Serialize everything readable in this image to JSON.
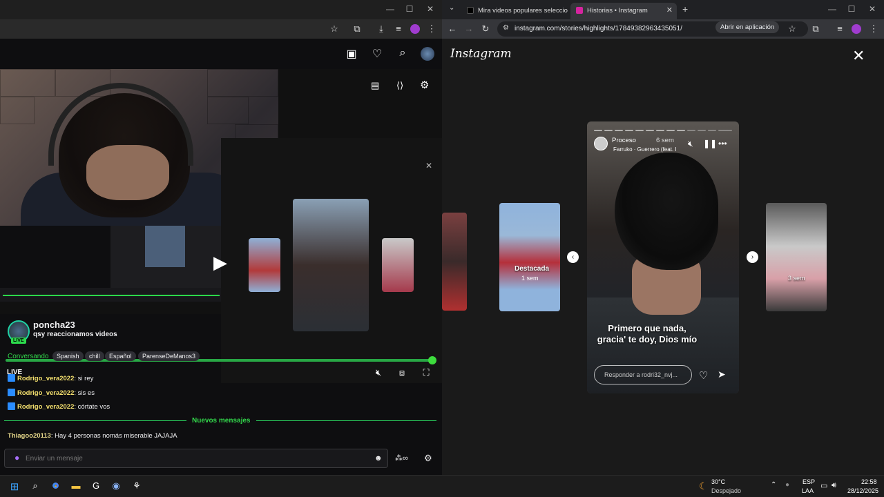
{
  "left_window": {
    "player": {
      "live_label": "LIVE"
    },
    "channel": {
      "name": "poncha23",
      "title": "qsy reaccionamos videos",
      "live_badge": "LIVE",
      "category": "Conversando",
      "tags": [
        "Spanish",
        "chill",
        "Español",
        "ParenseDeManos3"
      ]
    },
    "chat": {
      "messages": [
        {
          "user": "Rodrigo_vera2022",
          "text": "si rey"
        },
        {
          "user": "Rodrigo_vera2022",
          "text": "sis es"
        },
        {
          "user": "Rodrigo_vera2022",
          "text": "córtate vos"
        }
      ],
      "new_messages_label": "Nuevos mensajes",
      "after_new": {
        "user": "Thiagoo20113",
        "text": "Hay 4 personas nomás miserable JAJAJA"
      },
      "input_placeholder": "Enviar un mensaje"
    }
  },
  "right_window": {
    "tabs": [
      {
        "label": "Mira videos populares seleccio",
        "favicon_color": "#000000"
      },
      {
        "label": "Historias • Instagram",
        "favicon_color": "#d6249f"
      }
    ],
    "url": "instagram.com/stories/highlights/17849382963435051/",
    "open_in_app": "Abrir en aplicación",
    "instagram": {
      "logo": "Instagram",
      "story": {
        "user": "Proceso",
        "time": "6 sem",
        "song": "Farruko · Guerrero (feat. I",
        "caption": "Primero que nada, gracia' te doy, Dios mío",
        "reply_placeholder": "Responder a rodri32_nvj..."
      },
      "side_stories": [
        {
          "label": "Destacada",
          "time": "1 sem"
        },
        {
          "label": "",
          "time": "3 sem"
        }
      ]
    }
  },
  "taskbar": {
    "weather_temp": "30°C",
    "weather_desc": "Despejado",
    "lang1": "ESP",
    "lang2": "LAA",
    "time": "22:58",
    "date": "28/12/2025"
  },
  "colors": {
    "twitch_green": "#32d74b",
    "accent_purple": "#a970ff",
    "chat_username": "#f4e06e"
  }
}
